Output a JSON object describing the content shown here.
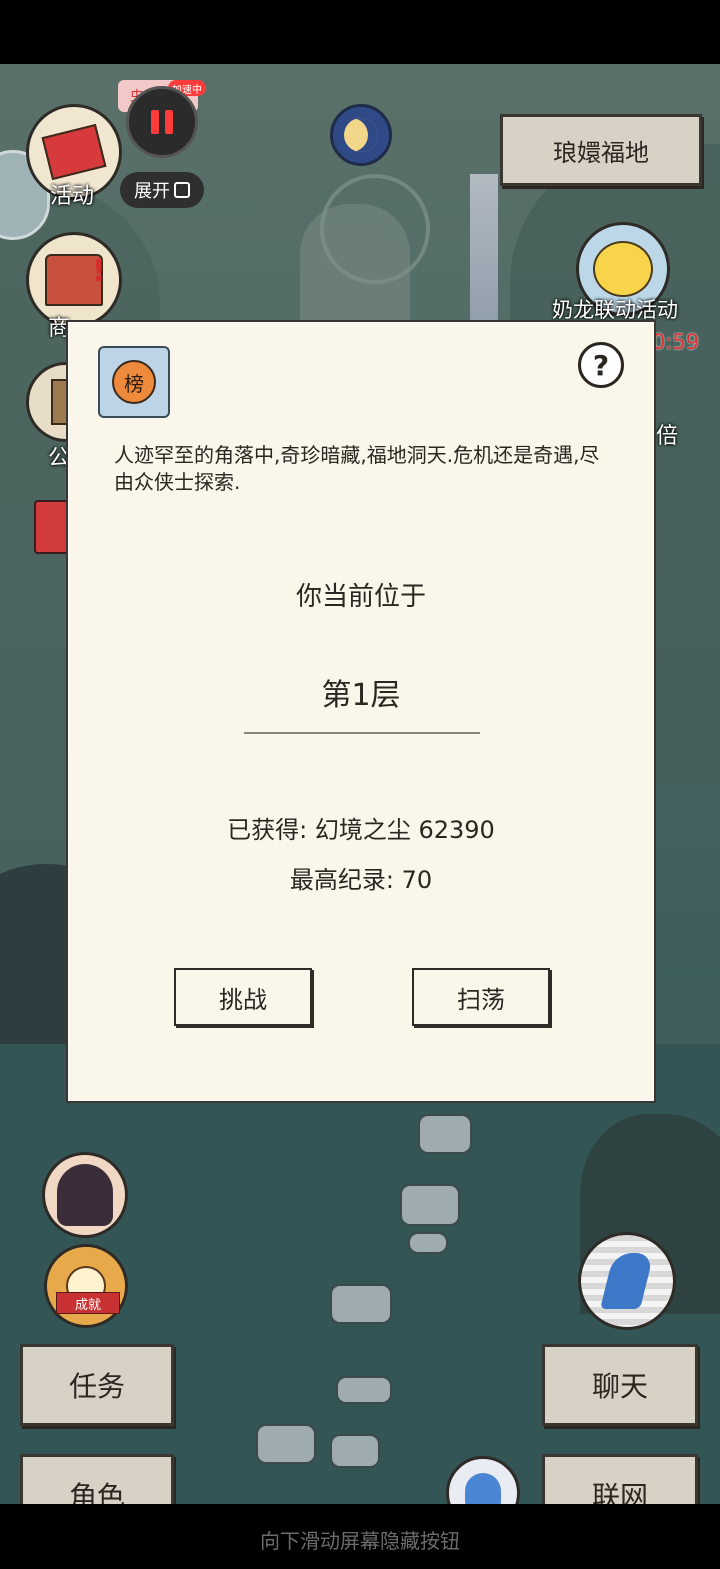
{
  "top_bar": {
    "app_badge": "虫虫助手",
    "accel_tag": "加速中",
    "expand_label": "展开"
  },
  "location_button": "琅嬛福地",
  "left_menu": {
    "activity_label": "活动",
    "shop_label": "商",
    "notice_label": "公"
  },
  "event": {
    "label": "奶龙联动活动",
    "timer": "0:59",
    "right_label": "倍"
  },
  "dialog": {
    "rank_glyph": "榜",
    "help_glyph": "?",
    "description": "人迹罕至的角落中,奇珍暗藏,福地洞天.危机还是奇遇,尽由众侠士探索.",
    "location_label": "你当前位于",
    "floor": "第1层",
    "obtained": "已获得: 幻境之尘 62390",
    "record": "最高纪录: 70",
    "challenge_button": "挑战",
    "sweep_button": "扫荡"
  },
  "bottom_left": {
    "task_button": "任务",
    "role_button": "角色",
    "achievement_badge": "成就"
  },
  "bottom_right": {
    "chat_button": "聊天",
    "online_button": "联网"
  },
  "hint": "向下滑动屏幕隐藏按钮",
  "colors": {
    "panel_bg": "#fbf6ea",
    "button_bg": "#d8d2c6",
    "scene_teal": "#4d6a66",
    "event_timer": "#e03030"
  },
  "icons": {
    "pause": "pause-icon",
    "moon": "moon-orb-icon",
    "help": "question-icon",
    "run": "running-figure-icon",
    "meditate": "meditation-icon"
  }
}
